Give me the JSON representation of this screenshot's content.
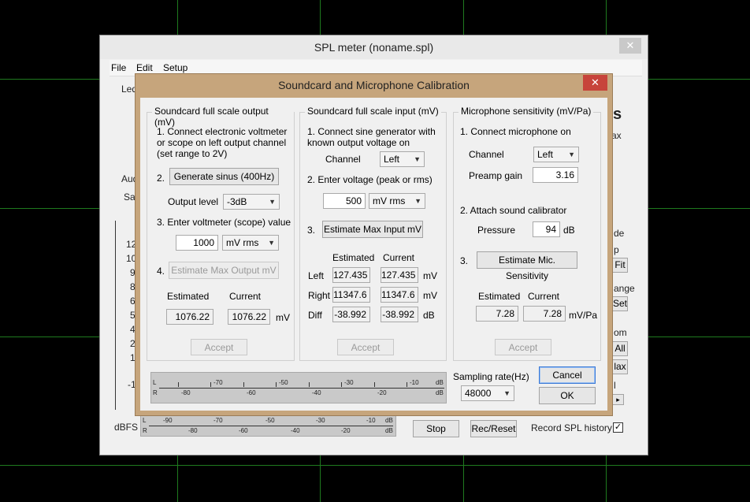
{
  "main_window": {
    "title": "SPL meter (noname.spl)",
    "close_icon": "✕",
    "menu": [
      "File",
      "Edit",
      "Setup"
    ],
    "bg_fragments": {
      "leq": "Leq",
      "aud": "Aud",
      "sa": "Sa",
      "s_big": "s",
      "ax": "ax",
      "de": "de",
      "p": "p",
      "fit": "Fit",
      "ange": "ange",
      "set": "Set",
      "om": "om",
      "all": "All",
      "lax": "lax",
      "l": "l",
      "arrow": "▸"
    },
    "axis_ticks": [
      "12",
      "10",
      "9",
      "8",
      "6",
      "5",
      "4",
      "2",
      "1",
      "-1"
    ],
    "dbfs_label": "dBFS",
    "meter_top_labels": [
      "-90",
      "-80",
      "-70",
      "-60",
      "-50",
      "-40",
      "-30",
      "-20",
      "-10",
      "dB"
    ],
    "meter_bot_labels": [
      "-80",
      "-60",
      "-40",
      "-20",
      "dB"
    ],
    "meter_lr": [
      "L",
      "R"
    ],
    "stop_label": "Stop",
    "rec_reset_label": "Rec/Reset",
    "record_history_label": "Record SPL history",
    "record_history_checked": "✓"
  },
  "dialog": {
    "title": "Soundcard and Microphone Calibration",
    "close_icon": "✕",
    "output": {
      "title": "Soundcard full scale output (mV)",
      "step1": "1. Connect electronic voltmeter or scope on left output channel (set range  to 2V)",
      "step2_num": "2.",
      "generate_label": "Generate sinus (400Hz)",
      "output_level_label": "Output level",
      "output_level_value": "-3dB",
      "step3": "3. Enter voltmeter (scope) value",
      "voltmeter_value": "1000",
      "voltmeter_unit": "mV rms",
      "step4_num": "4.",
      "estimate_label": "Estimate Max Output mV",
      "estimated_label": "Estimated",
      "current_label": "Current",
      "estimated_value": "1076.22",
      "current_value": "1076.22",
      "unit": "mV",
      "accept_label": "Accept"
    },
    "input": {
      "title": "Soundcard full scale  input (mV)",
      "step1": "1. Connect sine generator with known output voltage on",
      "channel_label": "Channel",
      "channel_value": "Left",
      "step2": "2. Enter voltage (peak or rms)",
      "voltage_value": "500",
      "voltage_unit": "mV rms",
      "step3_num": "3.",
      "estimate_label": "Estimate Max Input mV",
      "estimated_label": "Estimated",
      "current_label": "Current",
      "rows": [
        {
          "label": "Left",
          "estimated": "127.435",
          "current": "127.435",
          "unit": "mV"
        },
        {
          "label": "Right",
          "estimated": "11347.6",
          "current": "11347.6",
          "unit": "mV"
        },
        {
          "label": "Diff",
          "estimated": "-38.992",
          "current": "-38.992",
          "unit": "dB"
        }
      ],
      "accept_label": "Accept"
    },
    "mic": {
      "title": "Microphone sensitivity (mV/Pa)",
      "step1": "1. Connect microphone on",
      "channel_label": "Channel",
      "channel_value": "Left",
      "preamp_label": "Preamp  gain",
      "preamp_value": "3.16",
      "step2": "2. Attach sound calibrator",
      "pressure_label": "Pressure",
      "pressure_value": "94",
      "pressure_unit": "dB",
      "step3_num": "3.",
      "estimate_label": "Estimate Mic. Sensitivity",
      "estimated_label": "Estimated",
      "current_label": "Current",
      "estimated_value": "7.28",
      "current_value": "7.28",
      "unit": "mV/Pa",
      "accept_label": "Accept"
    },
    "meter": {
      "top_labels": [
        "-70",
        "-50",
        "-30",
        "-10",
        "dB"
      ],
      "bot_labels": [
        "-80",
        "-60",
        "-40",
        "-20",
        "dB"
      ],
      "lr": [
        "L",
        "R"
      ]
    },
    "sampling_label": "Sampling rate(Hz)",
    "sampling_value": "48000",
    "cancel_label": "Cancel",
    "ok_label": "OK"
  }
}
